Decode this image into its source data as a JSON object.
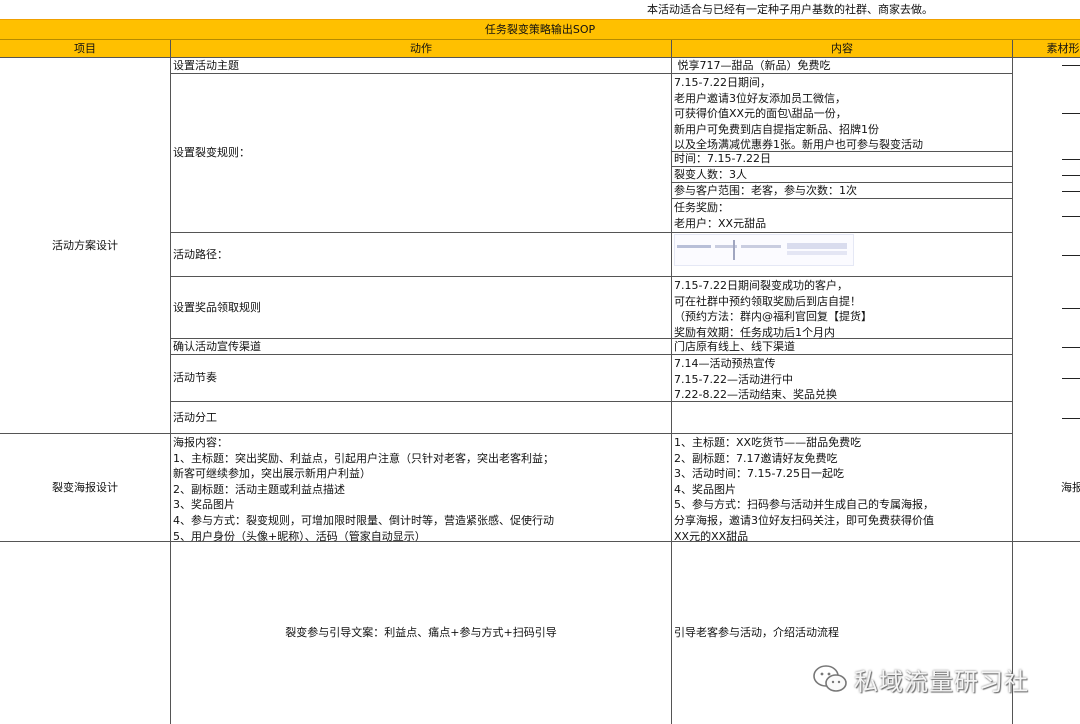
{
  "notice": "本活动适合与已经有一定种子用户基数的社群、商家去做。",
  "title": "任务裂变策略输出SOP",
  "headers": [
    "项目",
    "动作",
    "内容",
    "素材形"
  ],
  "sections": {
    "s1": "活动方案设计",
    "s2": "裂变海报设计",
    "s2_material": "海报"
  },
  "rows": {
    "theme": {
      "action": "设置活动主题",
      "content": " 悦享717—甜品（新品）免费吃"
    },
    "rules": {
      "action": "设置裂变规则：",
      "content1": "7.15-7.22日期间，\n老用户邀请3位好友添加员工微信，\n可获得价值XX元的面包\\甜品一份，\n新用户可免费到店自提指定新品、招牌1份\n以及全场满减优惠券1张。新用户也可参与裂变活动",
      "content2": "时间：7.15-7.22日",
      "content3": "裂变人数：3人",
      "content4": "参与客户范围：老客，参与次数：1次",
      "content5": "任务奖励：\n老用户：XX元甜品"
    },
    "route": {
      "action": "活动路径："
    },
    "reward": {
      "action": "设置奖品领取规则",
      "content": "7.15-7.22日期间裂变成功的客户，\n可在社群中预约领取奖励后到店自提！\n（预约方法：群内@福利官回复【提货】\n奖励有效期：任务成功后1个月内"
    },
    "channel": {
      "action": "确认活动宣传渠道",
      "content": "门店原有线上、线下渠道"
    },
    "rhythm": {
      "action": "活动节奏",
      "content": "7.14—活动预热宣传\n7.15-7.22—活动进行中\n7.22-8.22—活动结束、奖品兑换"
    },
    "division": {
      "action": "活动分工",
      "content": ""
    },
    "poster": {
      "action": "海报内容：\n1、主标题：突出奖励、利益点，引起用户注意（只针对老客，突出老客利益；\n新客可继续参加，突出展示新用户利益）\n2、副标题：活动主题或利益点描述\n3、奖品图片\n4、参与方式：裂变规则，可增加限时限量、倒计时等，营造紧张感、促使行动\n5、用户身份（头像+昵称）、活码（管家自动显示）",
      "content": "1、主标题：XX吃货节——甜品免费吃\n2、副标题：7.17邀请好友免费吃\n3、活动时间：7.15-7.25日一起吃\n4、奖品图片\n5、参与方式：扫码参与活动并生成自己的专属海报，\n分享海报，邀请3位好友扫码关注，即可免费获得价值\nXX元的XX甜品"
    },
    "copy": {
      "action": "裂变参与引导文案：利益点、痛点+参与方式+扫码引导",
      "content": "引导老客参与活动，介绍活动流程"
    }
  },
  "watermark": {
    "text": "私域流量研习社",
    "icon": "wechat-icon"
  },
  "colors": {
    "header": "#ffc000",
    "border": "#555555"
  }
}
